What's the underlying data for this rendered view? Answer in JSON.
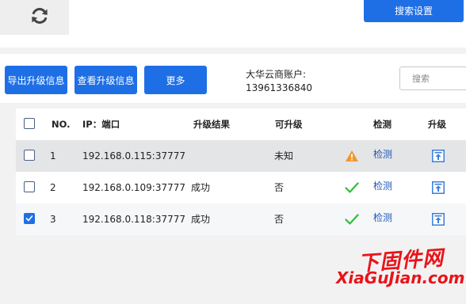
{
  "topbar": {
    "refresh_icon": "refresh-icon",
    "search_settings_label": "搜索设置"
  },
  "toolbar": {
    "export_label": "导出升级信息",
    "view_label": "查看升级信息",
    "more_label": "更多",
    "account_label": "大华云商账户:",
    "account_number": "13961336840",
    "search_placeholder": "搜索"
  },
  "table": {
    "headers": {
      "no": "NO.",
      "ip_port": "IP：端口",
      "result": "升级结果",
      "upgradable": "可升级",
      "detect": "检测",
      "upgrade": "升级"
    },
    "rows": [
      {
        "checked": false,
        "no": "1",
        "ip_port": "192.168.0.115:37777",
        "result": "",
        "upgradable": "未知",
        "status_icon": "warning-icon",
        "detect": "检测",
        "upgrade_icon": "upload-icon"
      },
      {
        "checked": false,
        "no": "2",
        "ip_port": "192.168.0.109:37777",
        "result": "成功",
        "upgradable": "否",
        "status_icon": "checkmark-icon",
        "detect": "检测",
        "upgrade_icon": "upload-icon"
      },
      {
        "checked": true,
        "no": "3",
        "ip_port": "192.168.0.118:37777",
        "result": "成功",
        "upgradable": "否",
        "status_icon": "checkmark-icon",
        "detect": "检测",
        "upgrade_icon": "upload-icon"
      }
    ]
  },
  "watermark": {
    "cn": "下固件网",
    "url": "XiaGuJian.com"
  },
  "colors": {
    "accent": "#1e6fe6",
    "warning": "#f0982c",
    "success": "#2fbf3a",
    "watermark": "#e8141a"
  }
}
